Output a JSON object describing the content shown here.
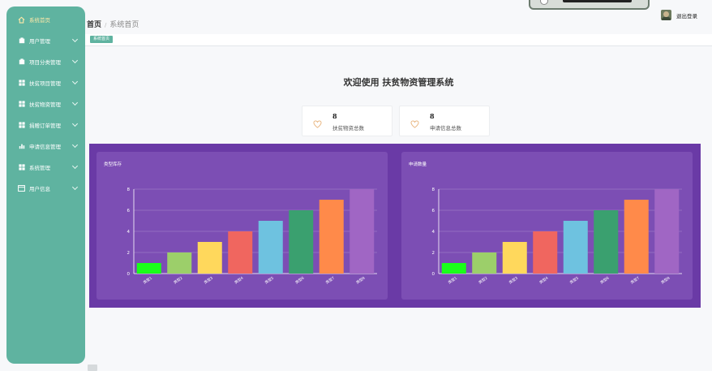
{
  "sidebar": {
    "items": [
      {
        "label": "系统首页",
        "icon": "home-icon",
        "active": true
      },
      {
        "label": "用户管理",
        "icon": "user-icon",
        "expandable": true
      },
      {
        "label": "项目分类管理",
        "icon": "box-icon",
        "expandable": true
      },
      {
        "label": "扶贫项目管理",
        "icon": "grid-icon",
        "expandable": true
      },
      {
        "label": "扶贫物资管理",
        "icon": "grid-icon",
        "expandable": true
      },
      {
        "label": "捐赠订单管理",
        "icon": "grid-icon",
        "expandable": true
      },
      {
        "label": "申请信息管理",
        "icon": "chart-icon",
        "expandable": true
      },
      {
        "label": "系统管理",
        "icon": "grid-icon",
        "expandable": true
      },
      {
        "label": "用户信息",
        "icon": "card-icon",
        "expandable": true
      }
    ]
  },
  "breadcrumb": {
    "root": "首页",
    "separator": "/",
    "current": "系统首页"
  },
  "user": {
    "logout": "退出登录"
  },
  "tags": [
    "系统首页"
  ],
  "welcome": "欢迎使用 扶贫物资管理系统",
  "stats": [
    {
      "value": "8",
      "label": "扶贫物资总数",
      "icon": "heart-icon"
    },
    {
      "value": "8",
      "label": "申请信息总数",
      "icon": "heart-icon"
    }
  ],
  "colors": {
    "sidebar": "#5fb3a0",
    "chart_bg": "#6a3aa6",
    "panel_bg": "#7c4eb4",
    "bars": [
      "#1aff1a",
      "#9ccf6a",
      "#ffd85c",
      "#f0665f",
      "#6ec2e0",
      "#3aa06f",
      "#ff8a4a",
      "#a066c4"
    ]
  },
  "chart_data": [
    {
      "type": "bar",
      "title": "类型库存",
      "categories": [
        "类型1",
        "类型2",
        "类型3",
        "类型4",
        "类型5",
        "类型6",
        "类型7",
        "类型8"
      ],
      "values": [
        1,
        2,
        3,
        4,
        5,
        6,
        7,
        8
      ],
      "ylim": [
        0,
        8
      ],
      "yticks": [
        0,
        2,
        4,
        6,
        8
      ],
      "grid": true
    },
    {
      "type": "bar",
      "title": "申请数量",
      "categories": [
        "类型1",
        "类型2",
        "类型3",
        "类型4",
        "类型5",
        "类型6",
        "类型7",
        "类型8"
      ],
      "values": [
        1,
        2,
        3,
        4,
        5,
        6,
        7,
        8
      ],
      "ylim": [
        0,
        8
      ],
      "yticks": [
        0,
        2,
        4,
        6,
        8
      ],
      "grid": true
    }
  ]
}
